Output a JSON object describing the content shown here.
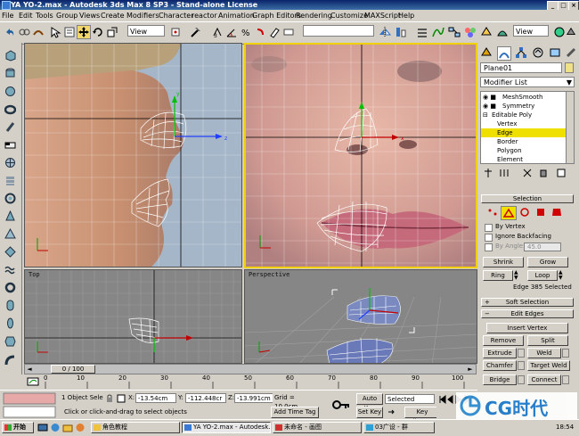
{
  "window": {
    "title": "YA YO-2.max - Autodesk 3ds Max 8 SP3 - Stand-alone License"
  },
  "menu": [
    "File",
    "Edit",
    "Tools",
    "Group",
    "Views",
    "Create",
    "Modifiers",
    "Character",
    "reactor",
    "Animation",
    "Graph Editors",
    "Rendering",
    "Customize",
    "MAXScript",
    "Help"
  ],
  "toolbar": {
    "view_dropdown": "View",
    "view_dropdown2": "View"
  },
  "viewports": {
    "bottom_left": {
      "label": "Top"
    },
    "bottom_right": {
      "label": "Perspective"
    }
  },
  "command_panel": {
    "object_name": "Plane01",
    "modifier_list": "Modifier List",
    "stack": [
      {
        "label": "MeshSmooth",
        "selected": false
      },
      {
        "label": "Symmetry",
        "selected": false
      },
      {
        "label": "Editable Poly",
        "selected": false
      },
      {
        "label": "Vertex",
        "selected": false
      },
      {
        "label": "Edge",
        "selected": true
      },
      {
        "label": "Border",
        "selected": false
      },
      {
        "label": "Polygon",
        "selected": false
      },
      {
        "label": "Element",
        "selected": false
      }
    ],
    "selection_rollout": "Selection",
    "by_vertex": "By Vertex",
    "ignore_backfacing": "Ignore Backfacing",
    "by_angle": "By Angle:",
    "angle_value": "45.0",
    "shrink": "Shrink",
    "grow": "Grow",
    "ring": "Ring",
    "loop": "Loop",
    "selection_info": "Edge 385 Selected",
    "soft_selection_rollout": "Soft Selection",
    "edit_edges_rollout": "Edit Edges",
    "insert_vertex": "Insert Vertex",
    "remove": "Remove",
    "split": "Split",
    "extrude": "Extrude",
    "weld": "Weld",
    "chamfer": "Chamfer",
    "target_weld": "Target Weld",
    "bridge": "Bridge",
    "connect": "Connect"
  },
  "timeline": {
    "frame_display": "0 / 100",
    "ticks": [
      "0",
      "10",
      "20",
      "30",
      "40",
      "50",
      "60",
      "70",
      "80",
      "90",
      "100"
    ]
  },
  "status": {
    "selection": "1 Object Sele",
    "prompt": "Click or click-and-drag to select objects",
    "x_label": "X:",
    "x_value": "-13.54cm",
    "y_label": "Y:",
    "y_value": "-112.448cr",
    "z_label": "Z:",
    "z_value": "-13.991cm",
    "grid": "Grid = 10.0cm",
    "add_time_tag": "Add Time Tag",
    "auto_key": "Auto Key",
    "set_key": "Set Key",
    "selected_dropdown": "Selected",
    "key_filters": "Key Filters..."
  },
  "taskbar": {
    "start": "开始",
    "tasks": [
      "角色教程",
      "YA YO-2.max - Autodesk...",
      "未命名 - 画图",
      "03广设 - 群"
    ],
    "clock": "18:54"
  },
  "watermark": "CG时代",
  "colors": {
    "active_viewport_border": "#f0d000",
    "selection_yellow": "#f0e000",
    "title_blue": "#0a246a"
  }
}
